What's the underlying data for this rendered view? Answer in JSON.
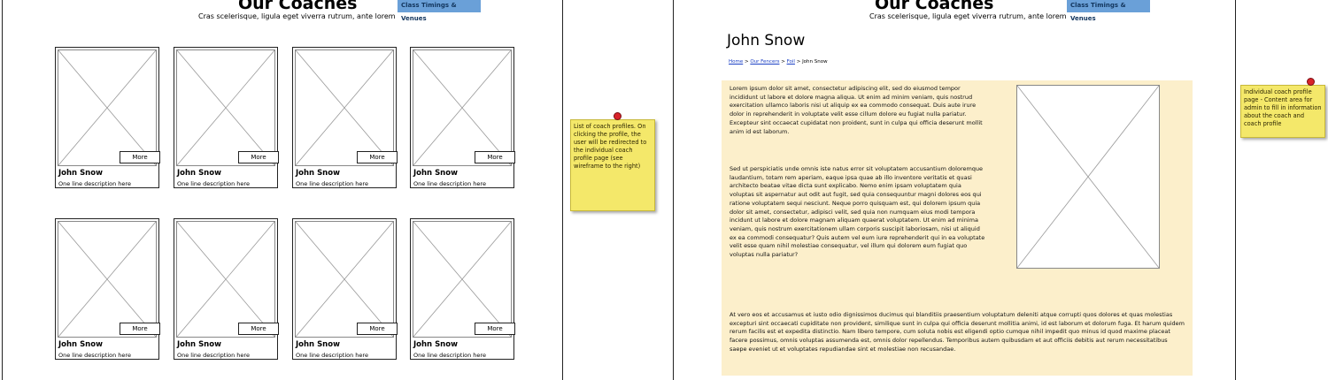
{
  "header": {
    "title": "Our Coaches",
    "subtitle": "Cras scelerisque, ligula eget viverra rutrum, ante lorem",
    "nav_tab": "Class Timings & Venues"
  },
  "coach_cards": [
    {
      "name": "John Snow",
      "description": "One line description here",
      "more_label": "More"
    },
    {
      "name": "John Snow",
      "description": "One line description here",
      "more_label": "More"
    },
    {
      "name": "John Snow",
      "description": "One line description here",
      "more_label": "More"
    },
    {
      "name": "John Snow",
      "description": "One line description here",
      "more_label": "More"
    },
    {
      "name": "John Snow",
      "description": "One line description here",
      "more_label": "More"
    },
    {
      "name": "John Snow",
      "description": "One line description here",
      "more_label": "More"
    },
    {
      "name": "John Snow",
      "description": "One line description here",
      "more_label": "More"
    },
    {
      "name": "John Snow",
      "description": "One line description here",
      "more_label": "More"
    }
  ],
  "notes": {
    "list_note": "List of coach profiles. On clicking the profile, the user will be redirected to the individual coach profile page (see wireframe to the right)",
    "profile_note": "Individual coach profile page - Content area for admin to fill in information about the coach and coach profile"
  },
  "profile": {
    "name": "John Snow",
    "breadcrumb": {
      "home": "Home",
      "sep": " > ",
      "fencers": "Our Fencers",
      "foil": "Foil",
      "current": "John Snow"
    },
    "paragraphs": [
      "Lorem ipsum dolor sit amet, consectetur adipiscing elit, sed do eiusmod tempor incididunt ut labore et dolore magna aliqua. Ut enim ad minim veniam, quis nostrud exercitation ullamco laboris nisi ut aliquip ex ea commodo consequat. Duis aute irure dolor in reprehenderit in voluptate velit esse cillum dolore eu fugiat nulla pariatur. Excepteur sint occaecat cupidatat non proident, sunt in culpa qui officia deserunt mollit anim id est laborum.",
      "Sed ut perspiciatis unde omnis iste natus error sit voluptatem accusantium doloremque laudantium, totam rem aperiam, eaque ipsa quae ab illo inventore veritatis et quasi architecto beatae vitae dicta sunt explicabo. Nemo enim ipsam voluptatem quia voluptas sit aspernatur aut odit aut fugit, sed quia consequuntur magni dolores eos qui ratione voluptatem sequi nesciunt. Neque porro quisquam est, qui dolorem ipsum quia dolor sit amet, consectetur, adipisci velit, sed quia non numquam eius modi tempora incidunt ut labore et dolore magnam aliquam quaerat voluptatem. Ut enim ad minima veniam, quis nostrum exercitationem ullam corporis suscipit laboriosam, nisi ut aliquid ex ea commodi consequatur? Quis autem vel eum iure reprehenderit qui in ea voluptate velit esse quam nihil molestiae consequatur, vel illum qui dolorem eum fugiat quo voluptas nulla pariatur?",
      "At vero eos et accusamus et iusto odio dignissimos ducimus qui blanditiis praesentium voluptatum deleniti atque corrupti quos dolores et quas molestias excepturi sint occaecati cupiditate non provident, similique sunt in culpa qui officia deserunt mollitia animi, id est laborum et dolorum fuga. Et harum quidem rerum facilis est et expedita distinctio. Nam libero tempore, cum soluta nobis est eligendi optio cumque nihil impedit quo minus id quod maxime placeat facere possimus, omnis voluptas assumenda est, omnis dolor repellendus. Temporibus autem quibusdam et aut officiis debitis aut rerum necessitatibus saepe eveniet ut et voluptates repudiandae sint et molestiae non recusandae."
    ]
  },
  "colors": {
    "nav_tab": "#6aa0d8",
    "sticky_note": "#f4e86a",
    "content_bg": "#fcefcb",
    "pin": "#d8232a",
    "link": "#1a3fc4"
  }
}
